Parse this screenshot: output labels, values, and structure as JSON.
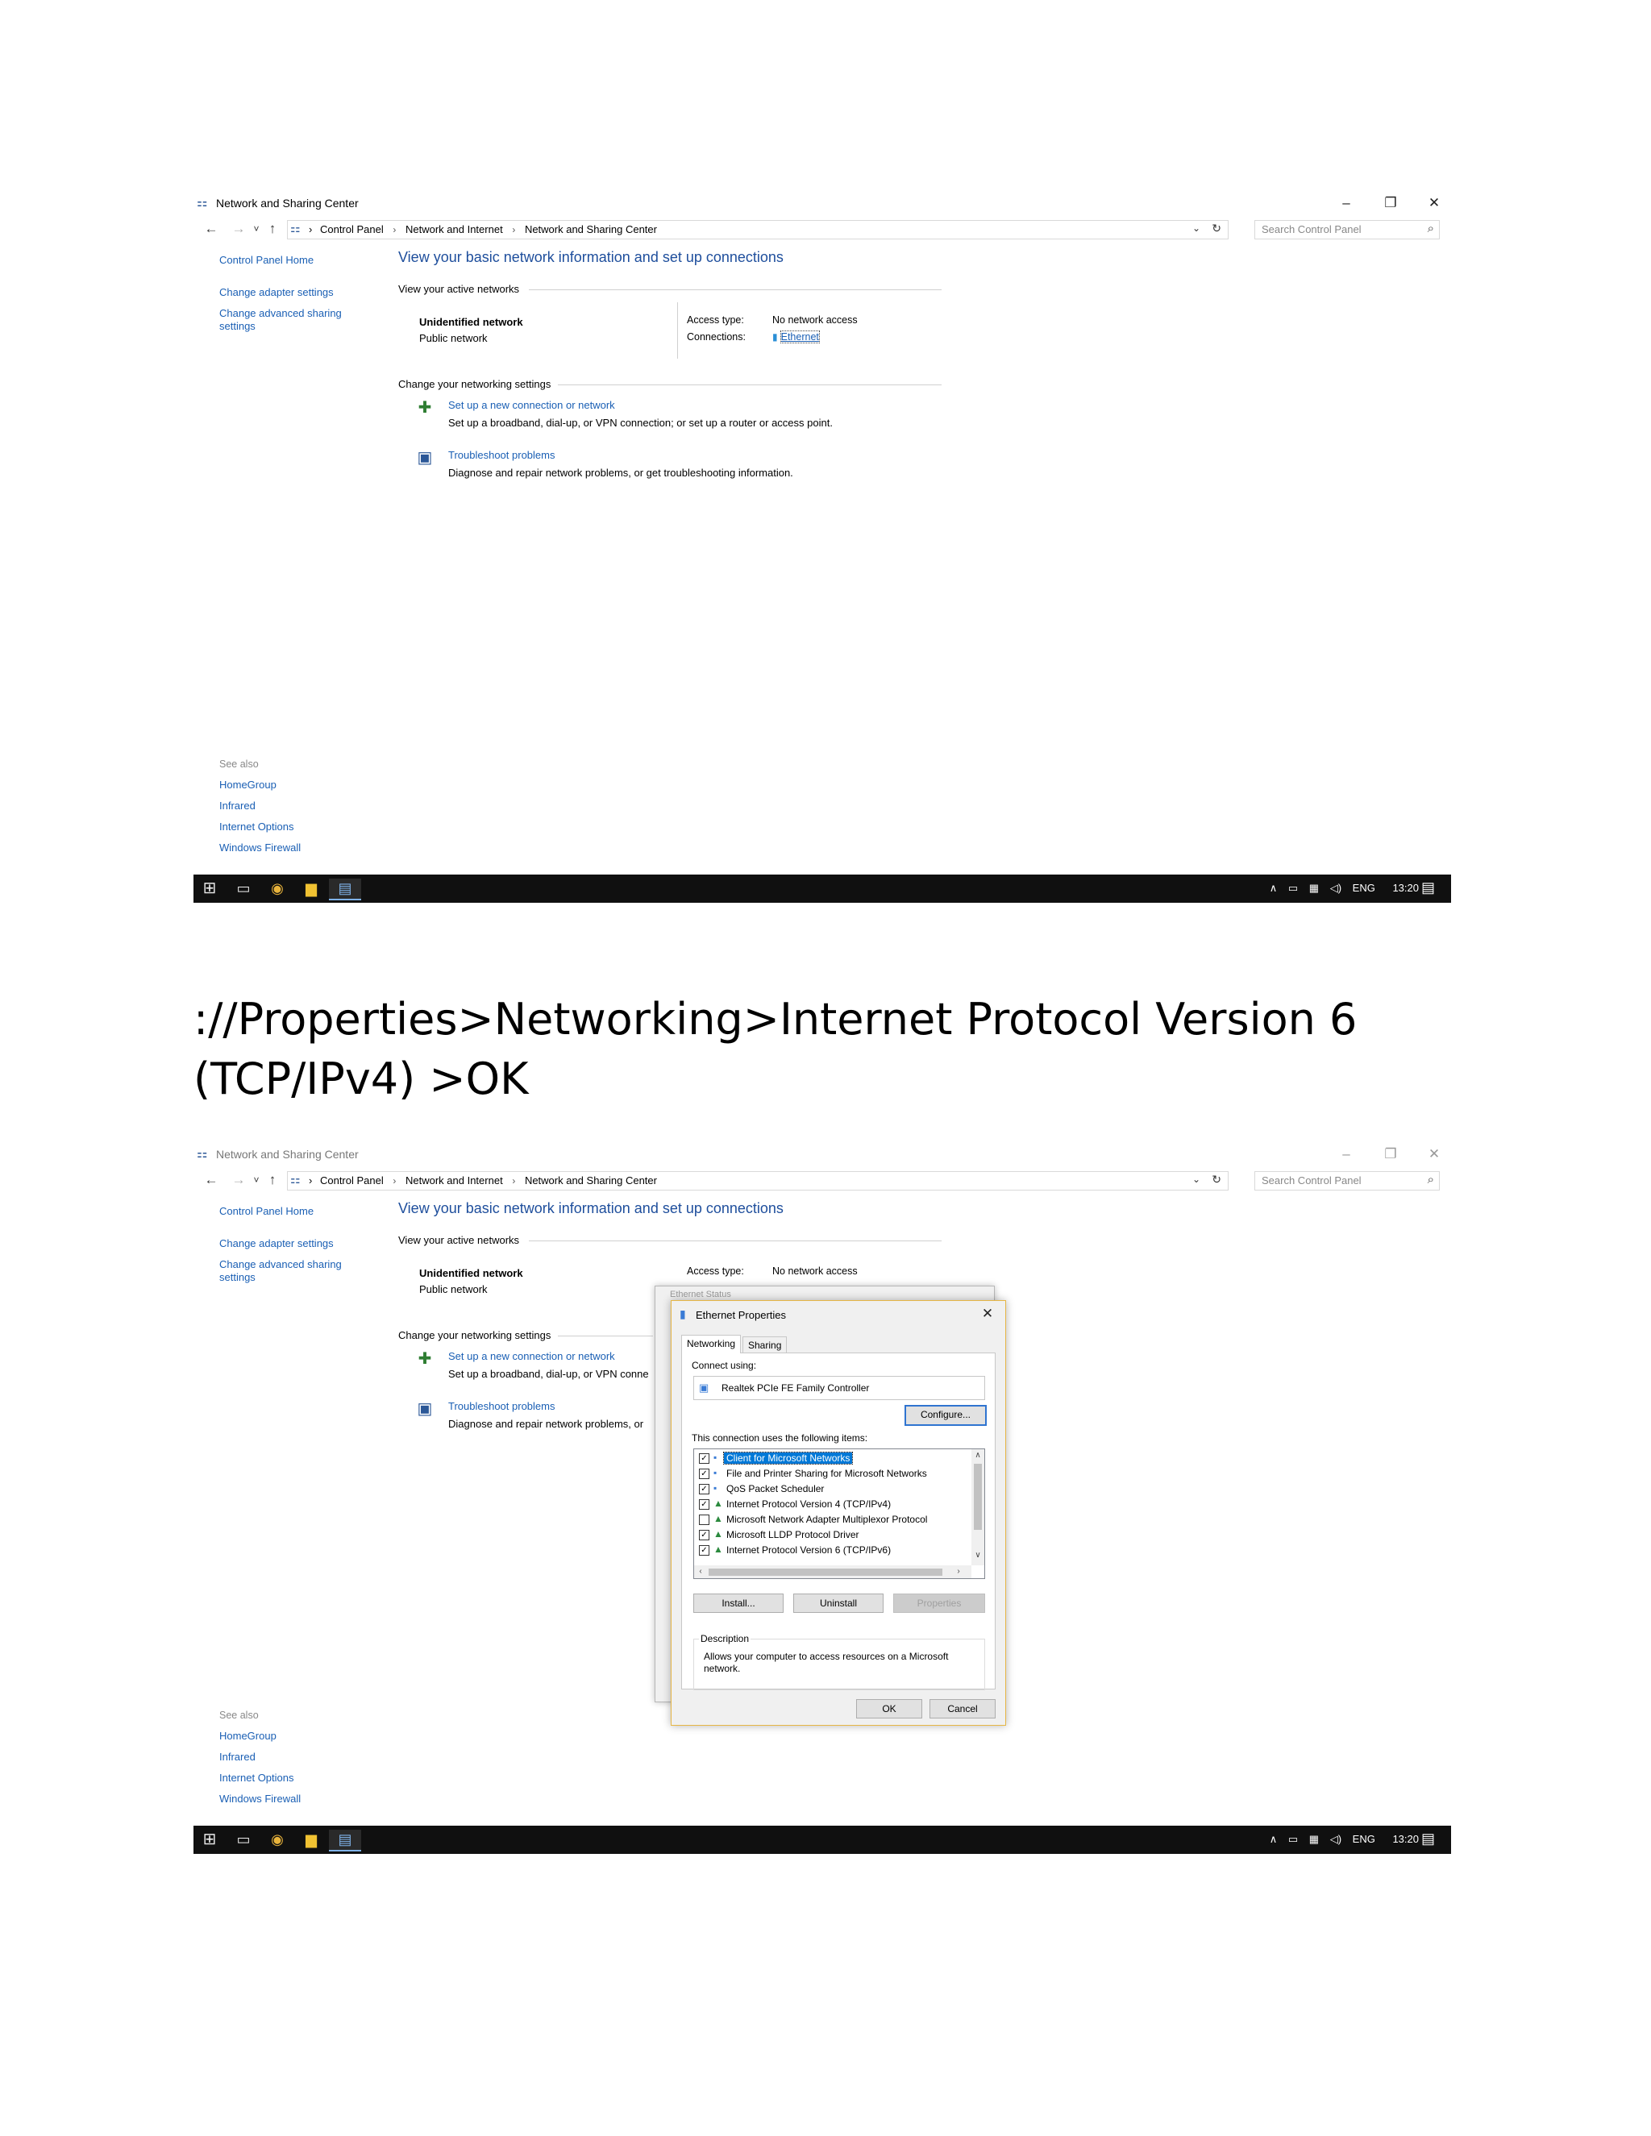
{
  "window": {
    "title": "Network and Sharing Center",
    "minimize": "–",
    "restore": "❐",
    "close": "✕"
  },
  "address": {
    "crumbs": [
      "Control Panel",
      "Network and Internet",
      "Network and Sharing Center"
    ],
    "search_placeholder": "Search Control Panel"
  },
  "nav": {
    "back": "←",
    "forward": "→",
    "recent": "˅",
    "up": "↑",
    "dropdown": "⌄",
    "refresh": "↻"
  },
  "sidebar": {
    "links": [
      "Control Panel Home",
      "Change adapter settings",
      "Change advanced sharing settings"
    ],
    "see_also_heading": "See also",
    "see_also": [
      "HomeGroup",
      "Infrared",
      "Internet Options",
      "Windows Firewall"
    ]
  },
  "main": {
    "title": "View your basic network information and set up connections",
    "active_networks_label": "View your active networks",
    "network_name": "Unidentified network",
    "network_category": "Public network",
    "access_type_label": "Access type:",
    "access_type_value": "No network access",
    "connections_label": "Connections:",
    "connections_value": "Ethernet",
    "change_settings_label": "Change your networking settings",
    "tasks": [
      {
        "link": "Set up a new connection or network",
        "desc": "Set up a broadband, dial-up, or VPN connection; or set up a router or access point."
      },
      {
        "link": "Troubleshoot problems",
        "desc": "Diagnose and repair network problems, or get troubleshooting information."
      }
    ],
    "tasks_desc_truncated": [
      "Set up a broadband, dial-up, or VPN conne",
      "Diagnose and repair network problems, or"
    ]
  },
  "taskbar": {
    "tray_lang": "ENG",
    "clock": "13:20"
  },
  "caption": {
    "line1": "://Properties>Networking>Internet Protocol Version 6",
    "line2": "(TCP/IPv4) >OK"
  },
  "status_dialog": {
    "title": "Ethernet Status"
  },
  "dialog": {
    "title": "Ethernet Properties",
    "tabs": [
      "Networking",
      "Sharing"
    ],
    "connect_using_label": "Connect using:",
    "adapter": "Realtek PCIe FE Family Controller",
    "configure_button": "Configure...",
    "items_label": "This connection uses the following items:",
    "items": [
      {
        "label": "Client for Microsoft Networks",
        "checked": true
      },
      {
        "label": "File and Printer Sharing for Microsoft Networks",
        "checked": true
      },
      {
        "label": "QoS Packet Scheduler",
        "checked": true
      },
      {
        "label": "Internet Protocol Version 4 (TCP/IPv4)",
        "checked": true
      },
      {
        "label": "Microsoft Network Adapter Multiplexor Protocol",
        "checked": false
      },
      {
        "label": "Microsoft LLDP Protocol Driver",
        "checked": true
      },
      {
        "label": "Internet Protocol Version 6 (TCP/IPv6)",
        "checked": true
      }
    ],
    "install_button": "Install...",
    "uninstall_button": "Uninstall",
    "properties_button": "Properties",
    "description_label": "Description",
    "description_text": "Allows your computer to access resources on a Microsoft network.",
    "ok_button": "OK",
    "cancel_button": "Cancel"
  }
}
